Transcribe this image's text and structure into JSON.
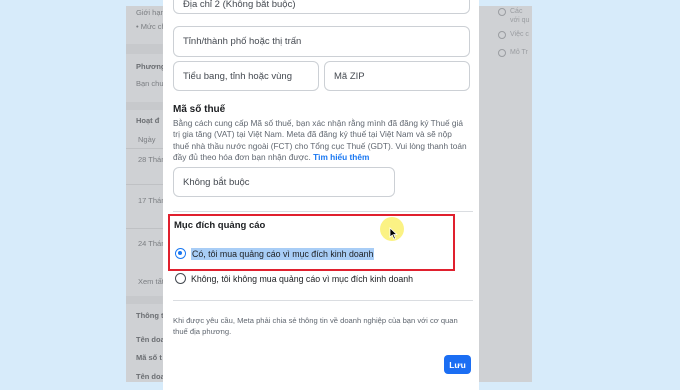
{
  "background": {
    "left_texts": [
      "Giới hạn",
      "• Mức ch",
      "Phương",
      "Bạn chư",
      "Hoạt đ",
      "Ngày",
      "28 Thán",
      "17 Thán",
      "24 Thán",
      "Xem tất",
      "Thông t",
      "Tên doa",
      "Mã số t",
      "Tên doa"
    ],
    "right_texts": [
      "Các",
      "với qu",
      "Việc c",
      "Mô Tr"
    ]
  },
  "form": {
    "address2_placeholder": "Địa chỉ 2 (Không bắt buộc)",
    "city_placeholder": "Tỉnh/thành phố hoặc thị trấn",
    "state_placeholder": "Tiểu bang, tỉnh hoặc vùng",
    "zip_placeholder": "Mã ZIP"
  },
  "tax": {
    "heading": "Mã số thuế",
    "description": "Bằng cách cung cấp Mã số thuế, bạn xác nhận rằng mình đã đăng ký Thuế giá trị gia tăng (VAT) tại Việt Nam. Meta đã đăng ký thuế tại Việt Nam và sẽ nộp thuế nhà thầu nước ngoài (FCT) cho Tổng cục Thuế (GDT). Vui lòng thanh toán đầy đủ theo hóa đơn bạn nhận được.",
    "learn_more": "Tìm hiểu thêm",
    "input_placeholder": "Không bắt buộc"
  },
  "purpose": {
    "heading": "Mục đích quảng cáo",
    "options": [
      {
        "label": "Có, tôi mua quảng cáo vì mục đích kinh doanh",
        "selected": true
      },
      {
        "label": "Không, tôi không mua quảng cáo vì mục đích kinh doanh",
        "selected": false
      }
    ]
  },
  "footer_note": "Khi được yêu cầu, Meta phải chia sẻ thông tin về doanh nghiệp của bạn với cơ quan thuế địa phương.",
  "save_label": "Lưu",
  "colors": {
    "accent": "#1877f2",
    "highlight": "#e0202e",
    "page_bg": "#d7ebfa"
  }
}
